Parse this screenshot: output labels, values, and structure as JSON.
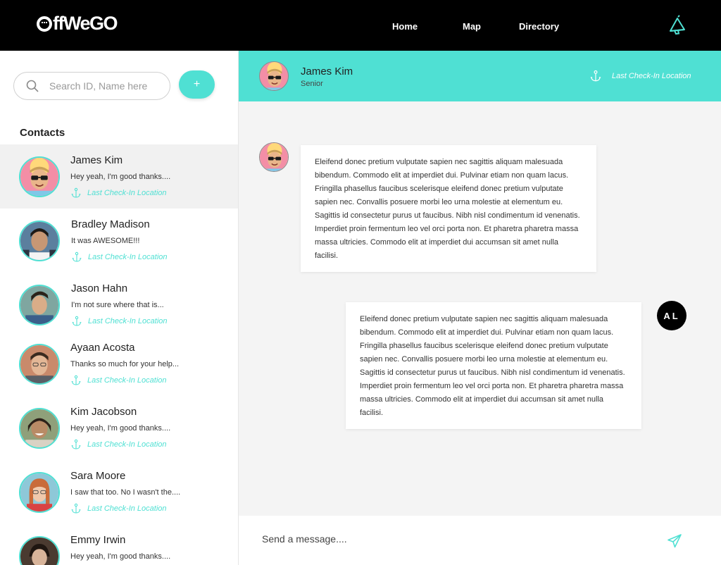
{
  "brand": {
    "name": "OffWeGo",
    "text_rest": "ffWeGO"
  },
  "nav": {
    "home": "Home",
    "map": "Map",
    "directory": "Directory"
  },
  "sidebar": {
    "search_placeholder": "Search ID, Name here",
    "add_label": "+",
    "contacts_title": "Contacts",
    "location_label": "Last Check-In Location",
    "contacts": [
      {
        "name": "James Kim",
        "preview": "Hey yeah, I'm good thanks...."
      },
      {
        "name": "Bradley Madison",
        "preview": "It was AWESOME!!!"
      },
      {
        "name": "Jason Hahn",
        "preview": "I'm not sure where that is..."
      },
      {
        "name": "Ayaan Acosta",
        "preview": "Thanks so much for your help..."
      },
      {
        "name": "Kim Jacobson",
        "preview": "Hey yeah, I'm good thanks...."
      },
      {
        "name": "Sara Moore",
        "preview": "I saw that too. No I wasn't the...."
      },
      {
        "name": "Emmy Irwin",
        "preview": "Hey yeah, I'm good thanks...."
      }
    ]
  },
  "chat": {
    "name": "James Kim",
    "role": "Senior",
    "location_label": "Last Check-In Location",
    "messages": [
      {
        "from": "James Kim",
        "text": "Eleifend donec pretium vulputate sapien nec sagittis aliquam malesuada bibendum. Commodo elit at imperdiet dui. Pulvinar etiam non quam lacus. Fringilla phasellus faucibus scelerisque eleifend donec pretium vulputate sapien nec. Convallis posuere morbi leo urna molestie at elementum eu. Sagittis id consectetur purus ut faucibus. Nibh nisl condimentum id venenatis. Imperdiet proin fermentum leo vel orci porta non. Et pharetra pharetra massa massa ultricies. Commodo elit at imperdiet dui accumsan sit amet nulla facilisi."
      },
      {
        "from": "AL",
        "text": "Eleifend donec pretium vulputate sapien nec sagittis aliquam malesuada bibendum. Commodo elit at imperdiet dui. Pulvinar etiam non quam lacus. Fringilla phasellus faucibus scelerisque eleifend donec pretium vulputate sapien nec. Convallis posuere morbi leo urna molestie at elementum eu. Sagittis id consectetur purus ut faucibus. Nibh nisl condimentum id venenatis. Imperdiet proin fermentum leo vel orci porta non. Et pharetra pharetra massa massa ultricies. Commodo elit at imperdiet dui accumsan sit amet nulla facilisi."
      }
    ],
    "composer_placeholder": "Send a message...."
  },
  "colors": {
    "accent": "#4fe0d3",
    "topbar": "#000000",
    "chat_bg": "#f4f4f4",
    "active_row": "#f1f1f1"
  }
}
